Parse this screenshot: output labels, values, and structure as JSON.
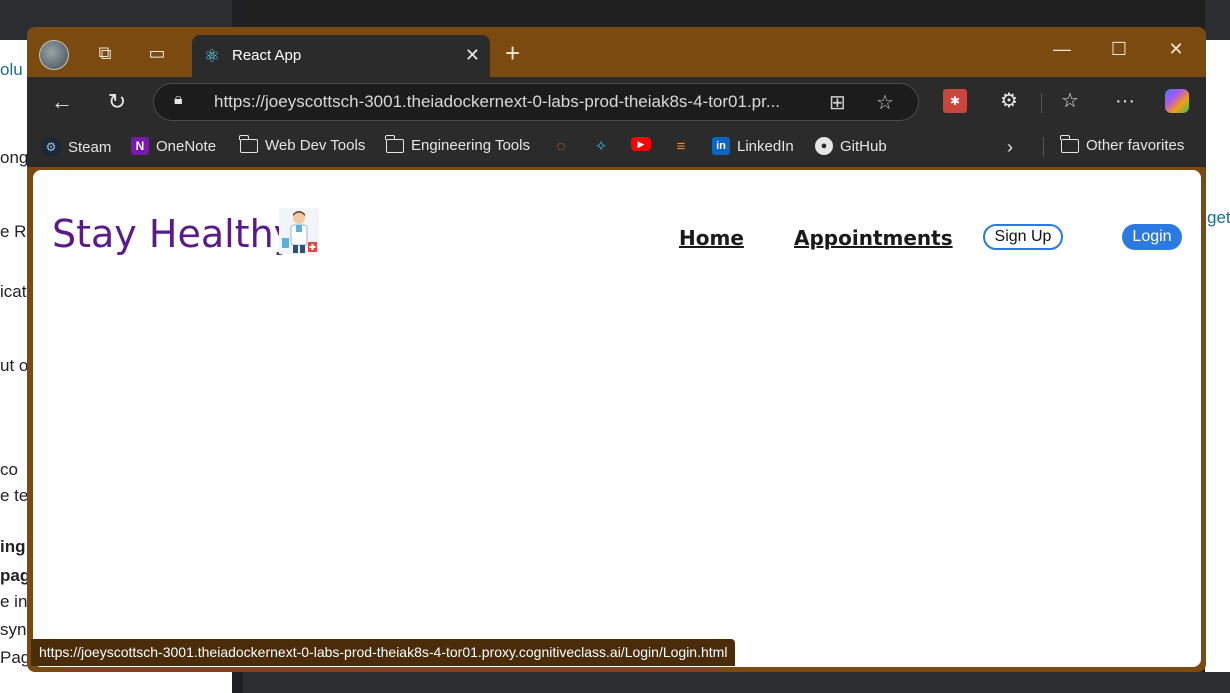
{
  "background": {
    "left_fragments": [
      "olu",
      "ong",
      "e R",
      "icat",
      "ut o",
      "co",
      "e te",
      "ing",
      "pag",
      "e in",
      "syn",
      "Pag"
    ],
    "right_fragment": "get"
  },
  "window": {
    "tab": {
      "icon": "react-icon",
      "title": "React App",
      "close": "✕"
    },
    "new_tab": "+",
    "controls": {
      "minimize": "—",
      "maximize": "☐",
      "close": "✕"
    }
  },
  "toolbar": {
    "back": "←",
    "refresh": "↻",
    "url": "https://joeyscottsch-3001.theiadockernext-0-labs-prod-theiak8s-4-tor01.pr...",
    "more": "···"
  },
  "favorites": [
    {
      "label": "Steam",
      "icon": "steam-icon"
    },
    {
      "label": "OneNote",
      "icon": "onenote-icon"
    },
    {
      "label": "Web Dev Tools",
      "icon": "folder-icon"
    },
    {
      "label": "Engineering Tools",
      "icon": "folder-icon"
    },
    {
      "label": "LinkedIn",
      "icon": "linkedin-icon"
    },
    {
      "label": "GitHub",
      "icon": "github-icon"
    },
    {
      "label": "Other favorites",
      "icon": "folder-icon"
    }
  ],
  "page": {
    "logo": "Stay Healthy",
    "nav": {
      "home": "Home",
      "appointments": "Appointments"
    },
    "signup": "Sign Up",
    "login": "Login"
  },
  "status_url": "https://joeyscottsch-3001.theiadockernext-0-labs-prod-theiak8s-4-tor01.proxy.cognitiveclass.ai/Login/Login.html",
  "colors": {
    "frame": "#7a4a10",
    "logo": "#5a1a8c",
    "accent": "#2a7ae2"
  }
}
